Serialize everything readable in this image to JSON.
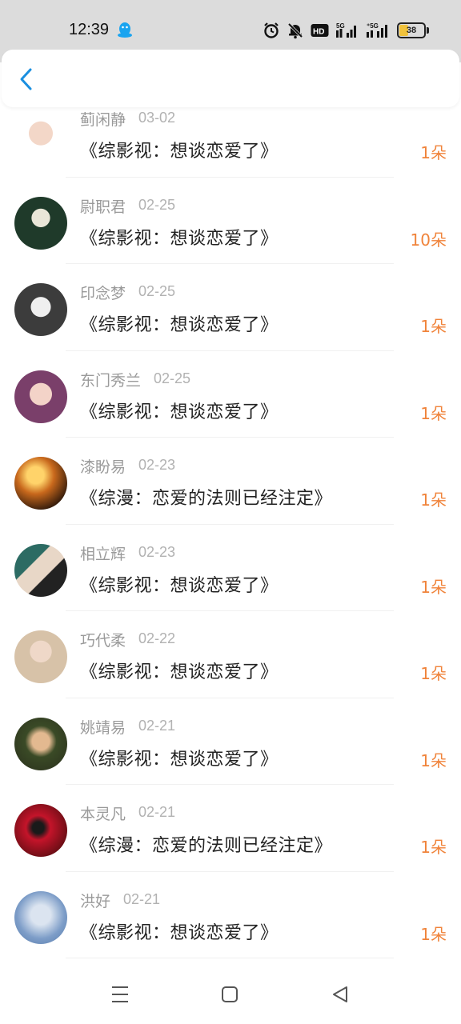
{
  "status_bar": {
    "time": "12:39",
    "battery": "38",
    "battery_level": 0.38,
    "icons": [
      "qq-icon",
      "alarm-icon",
      "mute-icon",
      "hd-icon",
      "signal-5g-icon",
      "signal-5g-icon",
      "battery-icon"
    ]
  },
  "header": {
    "back_icon": "chevron-left-icon"
  },
  "colors": {
    "accent": "#1a8fe0",
    "amount": "#f0833a",
    "name": "#9a9a9a",
    "text": "#222222"
  },
  "records": [
    {
      "name": "蓟闲静",
      "date": "03-02",
      "book": "《综影视：想谈恋爱了》",
      "amount": "1朵"
    },
    {
      "name": "尉职君",
      "date": "02-25",
      "book": "《综影视：想谈恋爱了》",
      "amount": "10朵"
    },
    {
      "name": "印念梦",
      "date": "02-25",
      "book": "《综影视：想谈恋爱了》",
      "amount": "1朵"
    },
    {
      "name": "东门秀兰",
      "date": "02-25",
      "book": "《综影视：想谈恋爱了》",
      "amount": "1朵"
    },
    {
      "name": "漆盼易",
      "date": "02-23",
      "book": "《综漫：恋爱的法则已经注定》",
      "amount": "1朵"
    },
    {
      "name": "相立辉",
      "date": "02-23",
      "book": "《综影视：想谈恋爱了》",
      "amount": "1朵"
    },
    {
      "name": "巧代柔",
      "date": "02-22",
      "book": "《综影视：想谈恋爱了》",
      "amount": "1朵"
    },
    {
      "name": "姚靖易",
      "date": "02-21",
      "book": "《综影视：想谈恋爱了》",
      "amount": "1朵"
    },
    {
      "name": "本灵凡",
      "date": "02-21",
      "book": "《综漫：恋爱的法则已经注定》",
      "amount": "1朵"
    },
    {
      "name": "洪好",
      "date": "02-21",
      "book": "《综影视：想谈恋爱了》",
      "amount": "1朵"
    }
  ],
  "navbar": {
    "icons": [
      "menu-icon",
      "home-square-icon",
      "back-triangle-icon"
    ]
  }
}
